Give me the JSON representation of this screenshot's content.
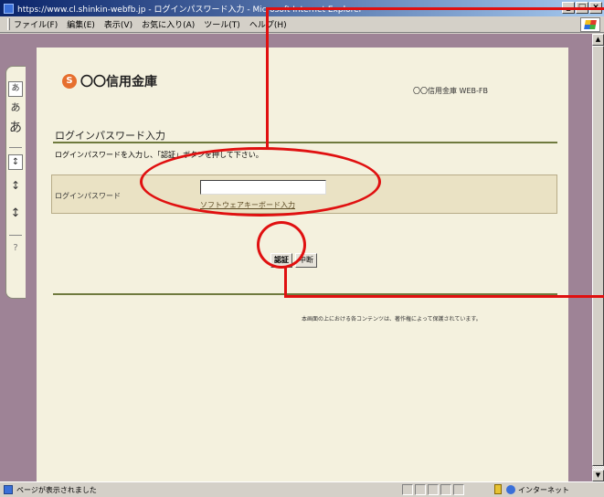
{
  "window": {
    "title": "https://www.cl.shinkin-webfb.jp - ログインパスワード入力 - Microsoft Internet Explorer",
    "controls": [
      "_",
      "□",
      "×"
    ]
  },
  "menubar": {
    "items": [
      "ファイル(F)",
      "編集(E)",
      "表示(V)",
      "お気に入り(A)",
      "ツール(T)",
      "ヘルプ(H)"
    ]
  },
  "sidetab": {
    "font_small": "あ",
    "font_medium": "あ",
    "font_large": "あ",
    "spacing_1": "↕",
    "spacing_2": "↕",
    "spacing_3": "↕",
    "help": "?"
  },
  "header": {
    "logo_mark": "S",
    "logo_text": "〇〇信用金庫",
    "bank_service": "〇〇信用金庫 WEB-FB"
  },
  "main": {
    "heading": "ログインパスワード入力",
    "instruction": "ログインパスワードを入力し、「認証」ボタンを押して下さい。",
    "form": {
      "label": "ログインパスワード",
      "password_value": "",
      "keyboard_link": "ソフトウェアキーボード入力"
    },
    "buttons": {
      "login": "認証",
      "cancel": "中断"
    },
    "copyright": "本画面の上における各コンテンツは、著作権によって保護されています。"
  },
  "statusbar": {
    "text": "ページが表示されました",
    "zone": "インターネット"
  },
  "colors": {
    "annotation": "#e01010",
    "page_bg": "#f4f1de",
    "frame_bg": "#9e8396",
    "accent_line": "#6f7a3e"
  }
}
